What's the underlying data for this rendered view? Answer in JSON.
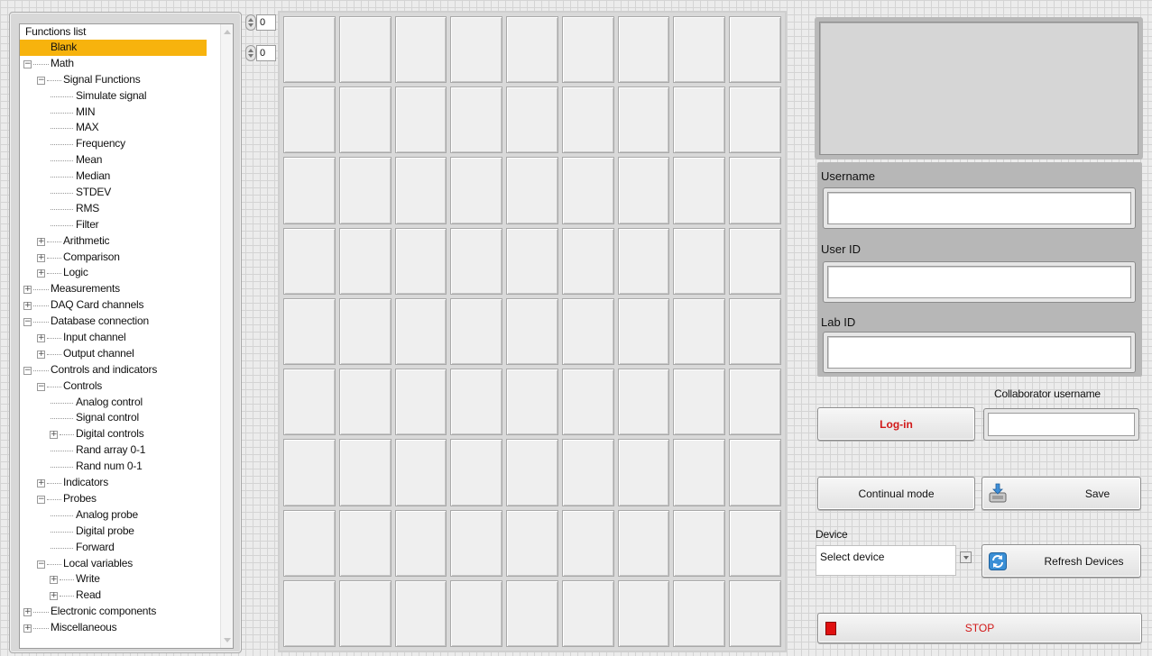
{
  "tree": {
    "header": "Functions list",
    "items": [
      {
        "label": "Blank",
        "indent": 1,
        "exp": "",
        "selected": true
      },
      {
        "label": "Math",
        "indent": 1,
        "exp": "minus"
      },
      {
        "label": "Signal Functions",
        "indent": 2,
        "exp": "minus"
      },
      {
        "label": "Simulate signal",
        "indent": 3,
        "exp": ""
      },
      {
        "label": "MIN",
        "indent": 3,
        "exp": ""
      },
      {
        "label": "MAX",
        "indent": 3,
        "exp": ""
      },
      {
        "label": "Frequency",
        "indent": 3,
        "exp": ""
      },
      {
        "label": "Mean",
        "indent": 3,
        "exp": ""
      },
      {
        "label": "Median",
        "indent": 3,
        "exp": ""
      },
      {
        "label": "STDEV",
        "indent": 3,
        "exp": ""
      },
      {
        "label": "RMS",
        "indent": 3,
        "exp": ""
      },
      {
        "label": "Filter",
        "indent": 3,
        "exp": ""
      },
      {
        "label": "Arithmetic",
        "indent": 2,
        "exp": "plus"
      },
      {
        "label": "Comparison",
        "indent": 2,
        "exp": "plus"
      },
      {
        "label": "Logic",
        "indent": 2,
        "exp": "plus"
      },
      {
        "label": "Measurements",
        "indent": 1,
        "exp": "plus"
      },
      {
        "label": "DAQ Card channels",
        "indent": 1,
        "exp": "plus"
      },
      {
        "label": "Database connection",
        "indent": 1,
        "exp": "minus"
      },
      {
        "label": "Input channel",
        "indent": 2,
        "exp": "plus"
      },
      {
        "label": "Output channel",
        "indent": 2,
        "exp": "plus"
      },
      {
        "label": "Controls and indicators",
        "indent": 1,
        "exp": "minus"
      },
      {
        "label": "Controls",
        "indent": 2,
        "exp": "minus"
      },
      {
        "label": "Analog control",
        "indent": 3,
        "exp": ""
      },
      {
        "label": "Signal control",
        "indent": 3,
        "exp": ""
      },
      {
        "label": "Digital controls",
        "indent": 3,
        "exp": "plus"
      },
      {
        "label": "Rand array 0-1",
        "indent": 3,
        "exp": ""
      },
      {
        "label": "Rand num 0-1",
        "indent": 3,
        "exp": ""
      },
      {
        "label": "Indicators",
        "indent": 2,
        "exp": "plus"
      },
      {
        "label": "Probes",
        "indent": 2,
        "exp": "minus"
      },
      {
        "label": "Analog probe",
        "indent": 3,
        "exp": ""
      },
      {
        "label": "Digital probe",
        "indent": 3,
        "exp": ""
      },
      {
        "label": "Forward",
        "indent": 3,
        "exp": ""
      },
      {
        "label": "Local variables",
        "indent": 2,
        "exp": "minus"
      },
      {
        "label": "Write",
        "indent": 3,
        "exp": "plus"
      },
      {
        "label": "Read",
        "indent": 3,
        "exp": "plus"
      },
      {
        "label": "Electronic components",
        "indent": 1,
        "exp": "plus"
      },
      {
        "label": "Miscellaneous",
        "indent": 1,
        "exp": "plus"
      }
    ]
  },
  "row_index": "0",
  "col_index": "0",
  "grid": {
    "rows": 9,
    "cols": 9
  },
  "login": {
    "username_label": "Username",
    "userid_label": "User ID",
    "labid_label": "Lab ID",
    "login_button": "Log-in",
    "collaborator_label": "Collaborator username"
  },
  "buttons": {
    "continual": "Continual mode",
    "save": "Save",
    "refresh": "Refresh Devices",
    "stop": "STOP"
  },
  "device": {
    "label": "Device",
    "selected": "Select device"
  },
  "colors": {
    "selection": "#f7b30d",
    "login_text": "#d11818",
    "stop_led": "#e01010"
  }
}
